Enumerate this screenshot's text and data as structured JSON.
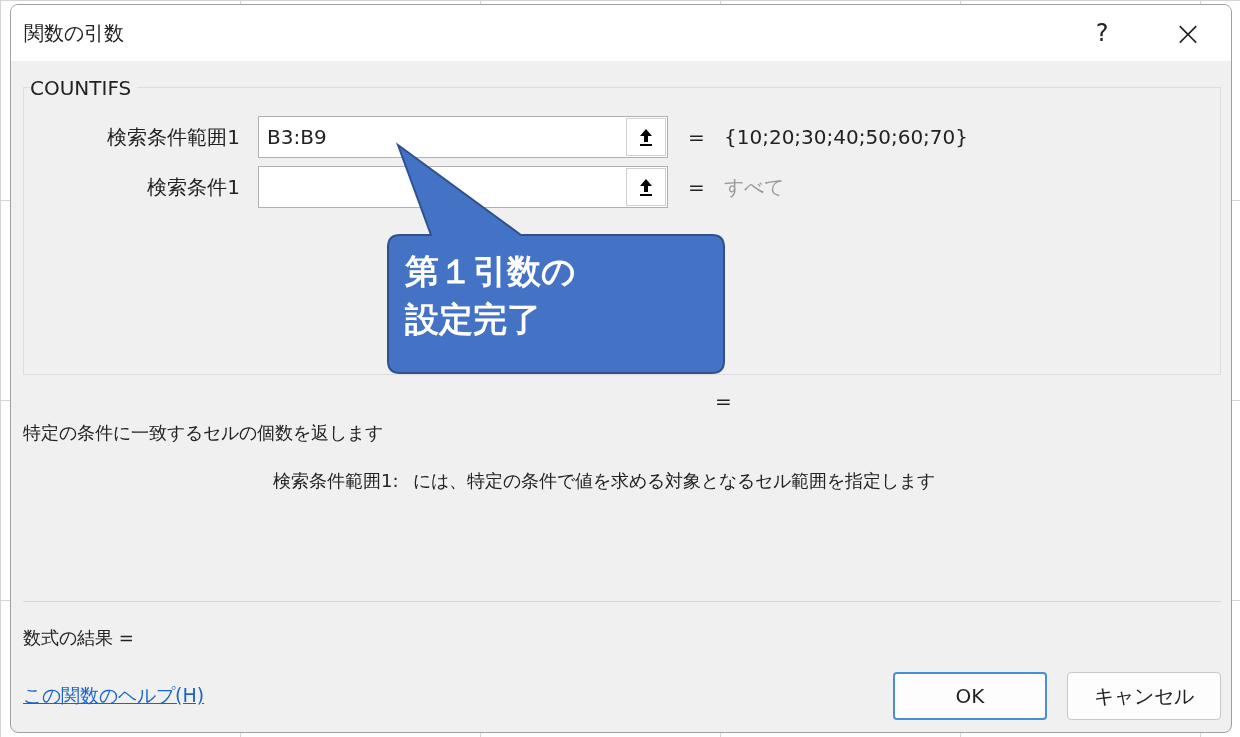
{
  "window": {
    "title": "関数の引数",
    "help_button": "?",
    "close_button": "×"
  },
  "function_name": "COUNTIFS",
  "arguments": [
    {
      "label": "検索条件範囲1",
      "value": "B3:B9",
      "equals": "=",
      "result": "{10;20;30;40;50;60;70}",
      "result_muted": false
    },
    {
      "label": "検索条件1",
      "equals": "=",
      "result": "すべて",
      "result_muted": true
    }
  ],
  "callout": {
    "text": "第１引数の設定完了"
  },
  "overall_equals": "=",
  "description": "特定の条件に一致するセルの個数を返します",
  "argument_help": {
    "label": "検索条件範囲1:",
    "text": "には、特定の条件で値を求める対象となるセル範囲を指定します"
  },
  "formula_result": "数式の結果 =",
  "help_link": "この関数のヘルプ(H)",
  "buttons": [
    {
      "label": "OK",
      "kind": "primary"
    },
    {
      "label": "キャンセル",
      "kind": "secondary"
    }
  ]
}
